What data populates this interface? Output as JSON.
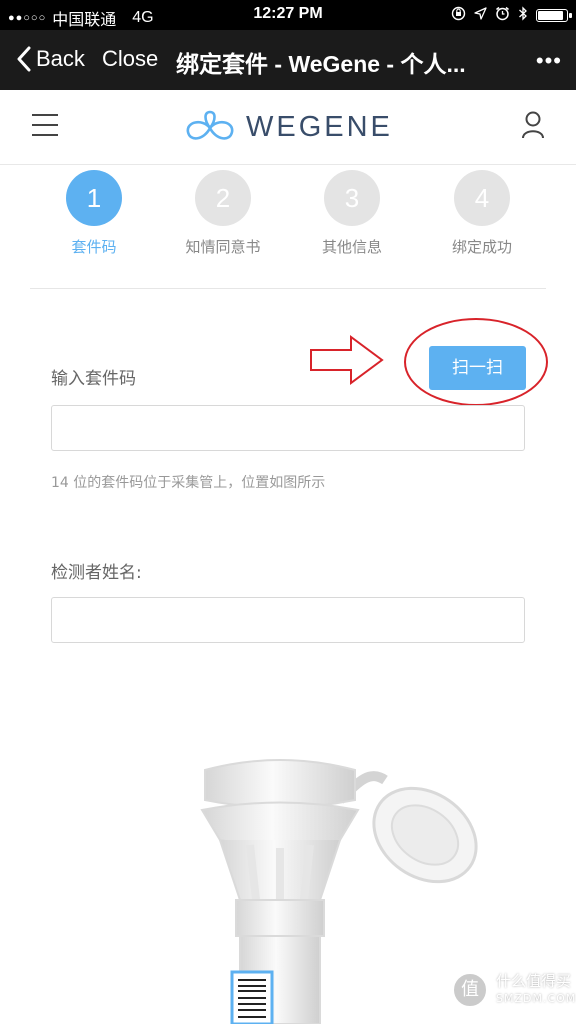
{
  "status_bar": {
    "signal_dots": "●●○○○",
    "carrier": "中国联通",
    "network": "4G",
    "time": "12:27 PM",
    "battery_level": 0.9,
    "icons": [
      "orientation-lock-icon",
      "location-arrow-icon",
      "alarm-icon",
      "bluetooth-icon",
      "battery-icon"
    ]
  },
  "nav_bar": {
    "back_label": "Back",
    "close_label": "Close",
    "title": "绑定套件 - WeGene - 个人...",
    "more_label": "•••"
  },
  "header": {
    "logo_text": "WEGENE",
    "menu_icon": "hamburger-menu-icon",
    "user_icon": "user-icon",
    "brand_color": "#394d6a"
  },
  "steps": [
    {
      "number": "1",
      "label": "套件码",
      "active": true
    },
    {
      "number": "2",
      "label": "知情同意书",
      "active": false
    },
    {
      "number": "3",
      "label": "其他信息",
      "active": false
    },
    {
      "number": "4",
      "label": "绑定成功",
      "active": false
    }
  ],
  "form": {
    "kit_code_label": "输入套件码",
    "kit_code_value": "",
    "scan_button": "扫一扫",
    "kit_code_hint": "14 位的套件码位于采集管上，位置如图所示",
    "name_label": "检测者姓名:",
    "name_value": ""
  },
  "watermark": {
    "badge": "值",
    "line1": "什么值得买",
    "line2": "SMZDM.COM"
  },
  "colors": {
    "accent": "#5db1f1",
    "annotation_red": "#d8232a",
    "inactive_step": "#e4e4e4"
  }
}
